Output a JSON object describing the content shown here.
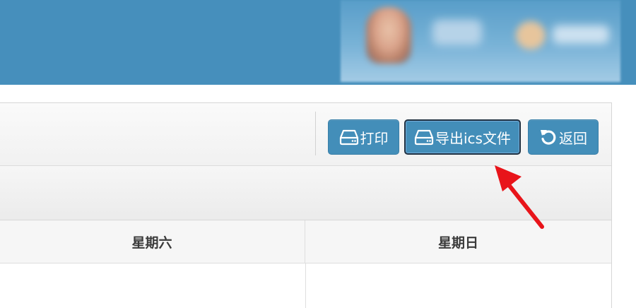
{
  "toolbar": {
    "print_label": "打印",
    "export_label": "导出ics文件",
    "back_label": "返回"
  },
  "calendar": {
    "columns": [
      "星期六",
      "星期日"
    ]
  },
  "colors": {
    "header_bg": "#468fbc",
    "button_bg": "#438eb9",
    "arrow": "#e8141a"
  },
  "icons": {
    "print": "hdd-icon",
    "export": "hdd-icon",
    "back": "undo-icon"
  }
}
